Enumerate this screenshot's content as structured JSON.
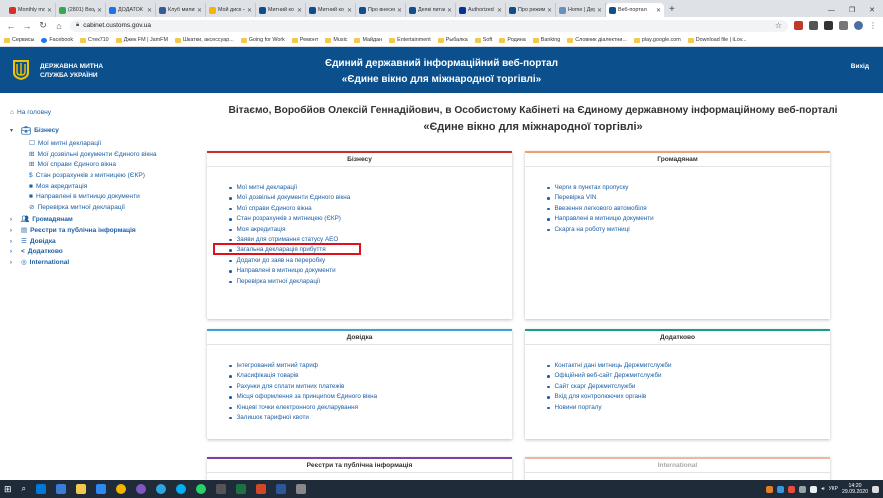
{
  "browser": {
    "tabs": [
      {
        "title": "Monthly mo",
        "color": "#d93025"
      },
      {
        "title": "(2801) Вход",
        "color": "#34a853"
      },
      {
        "title": "ДОДАТОК",
        "color": "#1a73e8"
      },
      {
        "title": "Клуб милих",
        "color": "#3b5998"
      },
      {
        "title": "Мой диск –",
        "color": "#f4b400"
      },
      {
        "title": "Митний ко",
        "color": "#0b4f8c"
      },
      {
        "title": "Митний ко",
        "color": "#0b4f8c"
      },
      {
        "title": "Про внесен",
        "color": "#0b4f8c"
      },
      {
        "title": "Деякі питан",
        "color": "#0b4f8c"
      },
      {
        "title": "Authorized",
        "color": "#003399"
      },
      {
        "title": "Про режим",
        "color": "#0b4f8c"
      },
      {
        "title": "Home | Дер",
        "color": "#6c8ebf"
      },
      {
        "title": "Веб-портал",
        "color": "#0b4f8c"
      }
    ],
    "url": "cabinet.customs.gov.ua",
    "bookmarks": [
      "Сервисы",
      "Facebook",
      "Стек710",
      "Джек FM | JamFM",
      "Шкатки, аксессуар...",
      "Going for Work",
      "Ремонт",
      "Music",
      "Майдан",
      "Entertainment",
      "Рыбалка",
      "Soft",
      "Родина",
      "Banking",
      "Словник діалектни...",
      "play.google.com",
      "Download file | iLov..."
    ]
  },
  "header": {
    "org_line1": "ДЕРЖАВНА МИТНА",
    "org_line2": "СЛУЖБА УКРАЇНИ",
    "title_line1": "Єдиний державний інформаційний веб-портал",
    "title_line2": "«Єдине вікно для міжнародної торгівлі»",
    "exit": "Вихід"
  },
  "sidebar": {
    "home": "На головну",
    "business": "Бізнесу",
    "business_items": [
      {
        "icon": "☐",
        "label": "Мої митні декларації"
      },
      {
        "icon": "⊞",
        "label": "Мої дозвільні документи Єдиного вікна"
      },
      {
        "icon": "⊞",
        "label": "Мої справи Єдиного вікна"
      },
      {
        "icon": "$",
        "label": "Стан розрахунків з митницею (ЄКР)"
      },
      {
        "icon": "■",
        "label": "Моя акредитація"
      },
      {
        "icon": "■",
        "label": "Направлені в митницю документи"
      },
      {
        "icon": "⊘",
        "label": "Перевірка митної декларації"
      }
    ],
    "sections": [
      {
        "label": "Громадянам"
      },
      {
        "label": "Реєстри та публічна інформація"
      },
      {
        "label": "Довідка"
      },
      {
        "label": "Додатково"
      },
      {
        "label": "International"
      }
    ]
  },
  "main": {
    "welcome_line1": "Вітаємо, Воробйов Олексій Геннадійович, в Особистому Кабінеті на Єдиному державному інформаційному веб-порталі",
    "welcome_line2": "«Єдине вікно для міжнародної торгівлі»",
    "cards": {
      "business": {
        "title": "Бізнесу",
        "items": [
          "Мої митні декларації",
          "Мої дозвільні документи Єдиного вікна",
          "Мої справи Єдиного вікна",
          "Стан розрахунків з митницею (ЄКР)",
          "Моя акредитація",
          "Заяви для отримання статусу АЕО",
          "Загальна декларація прибуття",
          "Додатки до заяв на переробку",
          "Направлені в митницю документи",
          "Перевірка митної декларації"
        ]
      },
      "citizens": {
        "title": "Громадянам",
        "items": [
          "Черги в пунктах пропуску",
          "Перевірка VIN",
          "Ввезення легкового автомобіля",
          "Направлені в митницю документи",
          "Скарга на роботу митниці"
        ]
      },
      "reference": {
        "title": "Довідка",
        "items": [
          "Інтегрований митний тариф",
          "Класифікація товарів",
          "Рахунки для сплати митних платежів",
          "Місця оформлення за принципом Єдиного вікна",
          "Кінцеві точки електронного декларування",
          "Залишок тарифної квоти"
        ]
      },
      "additional": {
        "title": "Додатково",
        "items": [
          "Контактні дані митниць Держмитслужби",
          "Офіційний веб-сайт Держмитслужби",
          "Сайт скарг Держмитслужби",
          "Вхід для контролюючих органів",
          "Новини порталу"
        ]
      },
      "registers": {
        "title": "Реєстри та публічна інформація"
      },
      "international": {
        "title": "International"
      }
    }
  },
  "colors": {
    "header_bg": "#0b4f8c",
    "link": "#1c5fa6",
    "business_accent": "#c9302c",
    "citizens_accent": "#f0a070",
    "reference_accent": "#3aa3d9",
    "additional_accent": "#15a085",
    "registers_accent": "#7b3fb5",
    "international_accent": "#f0b7a0",
    "highlight": "#e0111b"
  },
  "taskbar": {
    "time": "14:20",
    "date": "29.09.2020",
    "lang": "УКР"
  }
}
